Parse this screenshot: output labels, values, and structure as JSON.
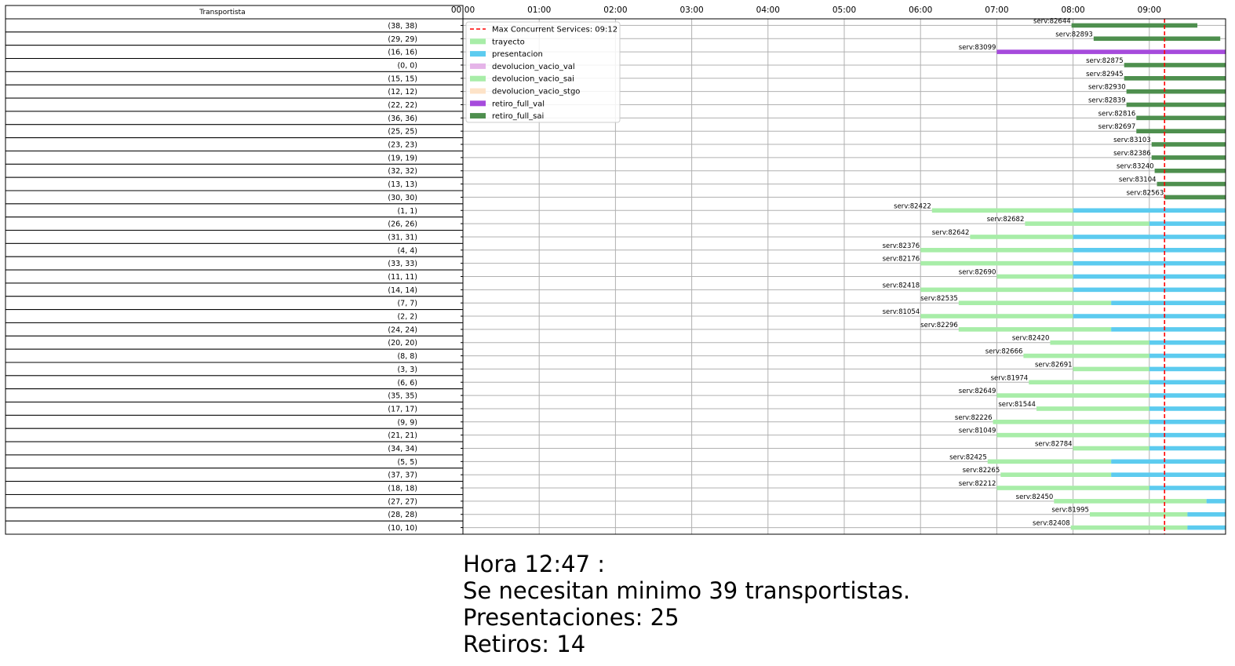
{
  "chart_data": {
    "type": "gantt",
    "table_header": "Transportista",
    "x_ticks": [
      "00:00",
      "01:00",
      "02:00",
      "03:00",
      "04:00",
      "05:00",
      "06:00",
      "07:00",
      "08:00",
      "09:00"
    ],
    "xlim_hours": [
      0,
      10
    ],
    "grid": true,
    "legend_position": "top-left",
    "vline": {
      "label": "Max Concurrent Services: 09:12",
      "time": "09:12",
      "color": "#ff0000"
    },
    "legend": [
      {
        "key": "vline",
        "label": "Max Concurrent Services: 09:12"
      },
      {
        "key": "trayecto",
        "label": "trayecto",
        "color": "#a8eda8"
      },
      {
        "key": "presentacion",
        "label": "presentacion",
        "color": "#5ccbef"
      },
      {
        "key": "devolucion_vacio_val",
        "label": "devolucion_vacio_val",
        "color": "#e5b4e8"
      },
      {
        "key": "devolucion_vacio_sai",
        "label": "devolucion_vacio_sai",
        "color": "#a8eda8"
      },
      {
        "key": "devolucion_vacio_stgo",
        "label": "devolucion_vacio_stgo",
        "color": "#fde3c8"
      },
      {
        "key": "retiro_full_val",
        "label": "retiro_full_val",
        "color": "#a64bdc"
      },
      {
        "key": "retiro_full_sai",
        "label": "retiro_full_sai",
        "color": "#4e8f4e"
      }
    ],
    "rows": [
      {
        "driver": "(38, 38)",
        "label": "serv:82644",
        "segments": [
          {
            "type": "retiro_full_sai",
            "start": 7.98,
            "end": 9.63
          }
        ]
      },
      {
        "driver": "(29, 29)",
        "label": "serv:82893",
        "segments": [
          {
            "type": "retiro_full_sai",
            "start": 8.27,
            "end": 9.93
          }
        ]
      },
      {
        "driver": "(16, 16)",
        "label": "serv:83099",
        "segments": [
          {
            "type": "retiro_full_val",
            "start": 7.0,
            "end": 10.0
          }
        ]
      },
      {
        "driver": "(0, 0)",
        "label": "serv:82875",
        "segments": [
          {
            "type": "retiro_full_sai",
            "start": 8.67,
            "end": 10.0
          }
        ]
      },
      {
        "driver": "(15, 15)",
        "label": "serv:82945",
        "segments": [
          {
            "type": "retiro_full_sai",
            "start": 8.67,
            "end": 10.0
          }
        ]
      },
      {
        "driver": "(12, 12)",
        "label": "serv:82930",
        "segments": [
          {
            "type": "retiro_full_sai",
            "start": 8.7,
            "end": 10.0
          }
        ]
      },
      {
        "driver": "(22, 22)",
        "label": "serv:82839",
        "segments": [
          {
            "type": "retiro_full_sai",
            "start": 8.7,
            "end": 10.0
          }
        ]
      },
      {
        "driver": "(36, 36)",
        "label": "serv:82816",
        "segments": [
          {
            "type": "retiro_full_sai",
            "start": 8.83,
            "end": 10.0
          }
        ]
      },
      {
        "driver": "(25, 25)",
        "label": "serv:82697",
        "segments": [
          {
            "type": "retiro_full_sai",
            "start": 8.83,
            "end": 10.0
          }
        ]
      },
      {
        "driver": "(23, 23)",
        "label": "serv:83103",
        "segments": [
          {
            "type": "retiro_full_sai",
            "start": 9.03,
            "end": 10.0
          }
        ]
      },
      {
        "driver": "(19, 19)",
        "label": "serv:82386",
        "segments": [
          {
            "type": "retiro_full_sai",
            "start": 9.03,
            "end": 10.0
          }
        ]
      },
      {
        "driver": "(32, 32)",
        "label": "serv:83240",
        "segments": [
          {
            "type": "retiro_full_sai",
            "start": 9.07,
            "end": 10.0
          }
        ]
      },
      {
        "driver": "(13, 13)",
        "label": "serv:83104",
        "segments": [
          {
            "type": "retiro_full_sai",
            "start": 9.1,
            "end": 10.0
          }
        ]
      },
      {
        "driver": "(30, 30)",
        "label": "serv:82563",
        "segments": [
          {
            "type": "retiro_full_sai",
            "start": 9.2,
            "end": 10.0
          }
        ]
      },
      {
        "driver": "(1, 1)",
        "label": "serv:82422",
        "segments": [
          {
            "type": "trayecto",
            "start": 6.15,
            "end": 8.0
          },
          {
            "type": "presentacion",
            "start": 8.0,
            "end": 10.0
          }
        ]
      },
      {
        "driver": "(26, 26)",
        "label": "serv:82682",
        "segments": [
          {
            "type": "trayecto",
            "start": 7.37,
            "end": 9.0
          },
          {
            "type": "presentacion",
            "start": 9.0,
            "end": 10.0
          }
        ]
      },
      {
        "driver": "(31, 31)",
        "label": "serv:82642",
        "segments": [
          {
            "type": "trayecto",
            "start": 6.65,
            "end": 8.0
          },
          {
            "type": "presentacion",
            "start": 8.0,
            "end": 10.0
          }
        ]
      },
      {
        "driver": "(4, 4)",
        "label": "serv:82376",
        "segments": [
          {
            "type": "trayecto",
            "start": 6.0,
            "end": 8.0
          },
          {
            "type": "presentacion",
            "start": 8.0,
            "end": 10.0
          }
        ]
      },
      {
        "driver": "(33, 33)",
        "label": "serv:82176",
        "segments": [
          {
            "type": "trayecto",
            "start": 6.0,
            "end": 8.0
          },
          {
            "type": "presentacion",
            "start": 8.0,
            "end": 10.0
          }
        ]
      },
      {
        "driver": "(11, 11)",
        "label": "serv:82690",
        "segments": [
          {
            "type": "trayecto",
            "start": 7.0,
            "end": 8.0
          },
          {
            "type": "presentacion",
            "start": 8.0,
            "end": 10.0
          }
        ]
      },
      {
        "driver": "(14, 14)",
        "label": "serv:82418",
        "segments": [
          {
            "type": "trayecto",
            "start": 6.0,
            "end": 8.0
          },
          {
            "type": "presentacion",
            "start": 8.0,
            "end": 10.0
          }
        ]
      },
      {
        "driver": "(7, 7)",
        "label": "serv:82535",
        "segments": [
          {
            "type": "trayecto",
            "start": 6.5,
            "end": 8.5
          },
          {
            "type": "presentacion",
            "start": 8.5,
            "end": 10.0
          }
        ]
      },
      {
        "driver": "(2, 2)",
        "label": "serv:81054",
        "segments": [
          {
            "type": "trayecto",
            "start": 6.0,
            "end": 8.0
          },
          {
            "type": "presentacion",
            "start": 8.0,
            "end": 10.0
          }
        ]
      },
      {
        "driver": "(24, 24)",
        "label": "serv:82296",
        "segments": [
          {
            "type": "trayecto",
            "start": 6.5,
            "end": 8.5
          },
          {
            "type": "presentacion",
            "start": 8.5,
            "end": 10.0
          }
        ]
      },
      {
        "driver": "(20, 20)",
        "label": "serv:82420",
        "segments": [
          {
            "type": "trayecto",
            "start": 7.7,
            "end": 9.0
          },
          {
            "type": "presentacion",
            "start": 9.0,
            "end": 10.0
          }
        ]
      },
      {
        "driver": "(8, 8)",
        "label": "serv:82666",
        "segments": [
          {
            "type": "trayecto",
            "start": 7.35,
            "end": 9.0
          },
          {
            "type": "presentacion",
            "start": 9.0,
            "end": 10.0
          }
        ]
      },
      {
        "driver": "(3, 3)",
        "label": "serv:82691",
        "segments": [
          {
            "type": "trayecto",
            "start": 8.0,
            "end": 9.0
          },
          {
            "type": "presentacion",
            "start": 9.0,
            "end": 10.0
          }
        ]
      },
      {
        "driver": "(6, 6)",
        "label": "serv:81974",
        "segments": [
          {
            "type": "trayecto",
            "start": 7.42,
            "end": 9.0
          },
          {
            "type": "presentacion",
            "start": 9.0,
            "end": 10.0
          }
        ]
      },
      {
        "driver": "(35, 35)",
        "label": "serv:82649",
        "segments": [
          {
            "type": "trayecto",
            "start": 7.0,
            "end": 9.0
          },
          {
            "type": "presentacion",
            "start": 9.0,
            "end": 10.0
          }
        ]
      },
      {
        "driver": "(17, 17)",
        "label": "serv:81544",
        "segments": [
          {
            "type": "trayecto",
            "start": 7.52,
            "end": 9.0
          },
          {
            "type": "presentacion",
            "start": 9.0,
            "end": 10.0
          }
        ]
      },
      {
        "driver": "(9, 9)",
        "label": "serv:82226",
        "segments": [
          {
            "type": "trayecto",
            "start": 6.95,
            "end": 9.0
          },
          {
            "type": "presentacion",
            "start": 9.0,
            "end": 10.0
          }
        ]
      },
      {
        "driver": "(21, 21)",
        "label": "serv:81049",
        "segments": [
          {
            "type": "trayecto",
            "start": 7.0,
            "end": 9.0
          },
          {
            "type": "presentacion",
            "start": 9.0,
            "end": 10.0
          }
        ]
      },
      {
        "driver": "(34, 34)",
        "label": "serv:82784",
        "segments": [
          {
            "type": "trayecto",
            "start": 8.0,
            "end": 9.0
          },
          {
            "type": "presentacion",
            "start": 9.0,
            "end": 10.0
          }
        ]
      },
      {
        "driver": "(5, 5)",
        "label": "serv:82425",
        "segments": [
          {
            "type": "trayecto",
            "start": 6.88,
            "end": 8.5
          },
          {
            "type": "presentacion",
            "start": 8.5,
            "end": 10.0
          }
        ]
      },
      {
        "driver": "(37, 37)",
        "label": "serv:82265",
        "segments": [
          {
            "type": "trayecto",
            "start": 7.05,
            "end": 8.5
          },
          {
            "type": "presentacion",
            "start": 8.5,
            "end": 10.0
          }
        ]
      },
      {
        "driver": "(18, 18)",
        "label": "serv:82212",
        "segments": [
          {
            "type": "trayecto",
            "start": 7.0,
            "end": 9.0
          },
          {
            "type": "presentacion",
            "start": 9.0,
            "end": 10.0
          }
        ]
      },
      {
        "driver": "(27, 27)",
        "label": "serv:82450",
        "segments": [
          {
            "type": "trayecto",
            "start": 7.75,
            "end": 9.75
          },
          {
            "type": "presentacion",
            "start": 9.75,
            "end": 10.0
          }
        ]
      },
      {
        "driver": "(28, 28)",
        "label": "serv:81995",
        "segments": [
          {
            "type": "trayecto",
            "start": 8.22,
            "end": 9.5
          },
          {
            "type": "presentacion",
            "start": 9.5,
            "end": 10.0
          }
        ]
      },
      {
        "driver": "(10, 10)",
        "label": "serv:82408",
        "segments": [
          {
            "type": "trayecto",
            "start": 7.97,
            "end": 9.5
          },
          {
            "type": "presentacion",
            "start": 9.5,
            "end": 10.0
          }
        ]
      }
    ]
  },
  "summary": {
    "line1": "Hora 12:47 :",
    "line2": "Se necesitan minimo 39 transportistas.",
    "line3": "Presentaciones: 25",
    "line4": "Retiros: 14"
  }
}
